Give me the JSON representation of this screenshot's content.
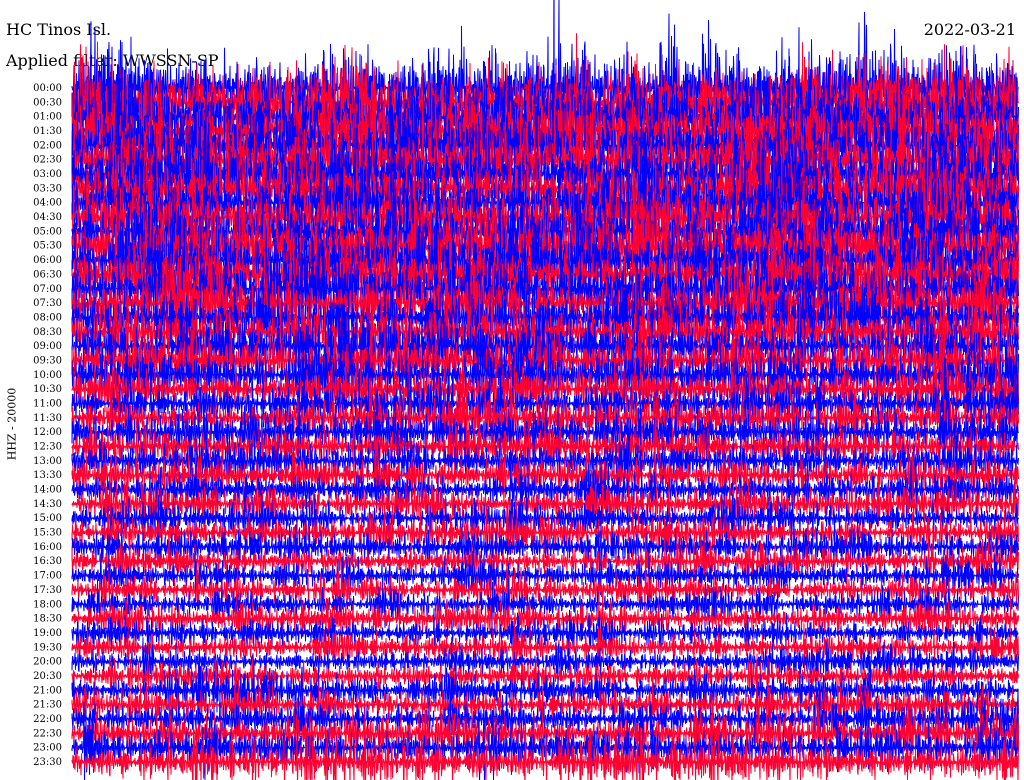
{
  "header": {
    "station": "HC Tinos Isl.",
    "date": "2022-03-21",
    "filter": "Applied filter: WWSSN-SP"
  },
  "chart_data": {
    "type": "line",
    "ylabel": "HHZ - 20000",
    "row_labels": [
      "00:00",
      "00:30",
      "01:00",
      "01:30",
      "02:00",
      "02:30",
      "03:00",
      "03:30",
      "04:00",
      "04:30",
      "05:00",
      "05:30",
      "06:00",
      "06:30",
      "07:00",
      "07:30",
      "08:00",
      "08:30",
      "09:00",
      "09:30",
      "10:00",
      "10:30",
      "11:00",
      "11:30",
      "12:00",
      "12:30",
      "13:00",
      "13:30",
      "14:00",
      "14:30",
      "15:00",
      "15:30",
      "16:00",
      "16:30",
      "17:00",
      "17:30",
      "18:00",
      "18:30",
      "19:00",
      "19:30",
      "20:00",
      "20:30",
      "21:00",
      "21:30",
      "22:00",
      "22:30",
      "23:00",
      "23:30"
    ],
    "series_colors": [
      "#ff0033",
      "#0000ff"
    ],
    "row_amplitude_relative": [
      2.6,
      2.6,
      2.6,
      2.5,
      2.5,
      2.5,
      2.4,
      2.4,
      2.4,
      2.3,
      2.3,
      2.2,
      2.2,
      2.1,
      2.1,
      2.0,
      1.9,
      1.8,
      1.7,
      1.6,
      1.6,
      1.5,
      1.4,
      1.3,
      1.3,
      1.2,
      1.2,
      1.1,
      1.1,
      1.1,
      1.0,
      1.0,
      1.0,
      0.95,
      0.9,
      0.9,
      0.85,
      0.85,
      0.8,
      0.8,
      0.85,
      0.9,
      0.95,
      1.0,
      1.05,
      1.15,
      1.25,
      1.4
    ]
  }
}
